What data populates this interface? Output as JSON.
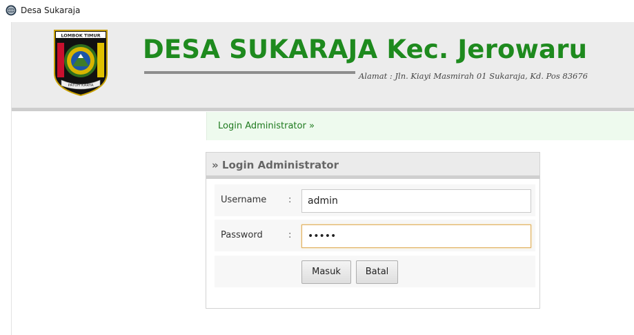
{
  "window": {
    "title": "Desa Sukaraja",
    "icon": "globe-icon"
  },
  "header": {
    "logo_name": "lombok-timur-emblem",
    "logo_top_text": "LOMBOK TIMUR",
    "logo_banner_text": "PATUH KARYA",
    "title": "DESA SUKARAJA Kec. Jerowaru",
    "address": "Alamat : Jln. Kiayi Masmirah 01 Sukaraja, Kd. Pos 83676"
  },
  "breadcrumb": {
    "text": "Login Administrator »"
  },
  "login": {
    "heading": "» Login Administrator",
    "username_label": "Username",
    "password_label": "Password",
    "separator": ":",
    "username_value": "admin",
    "password_value": "admin",
    "submit_label": "Masuk",
    "cancel_label": "Batal"
  },
  "colors": {
    "title_green": "#1e8a1e",
    "header_bg": "#ececec",
    "breadcrumb_bg": "#eefaee",
    "focus_border": "#e0b060"
  }
}
